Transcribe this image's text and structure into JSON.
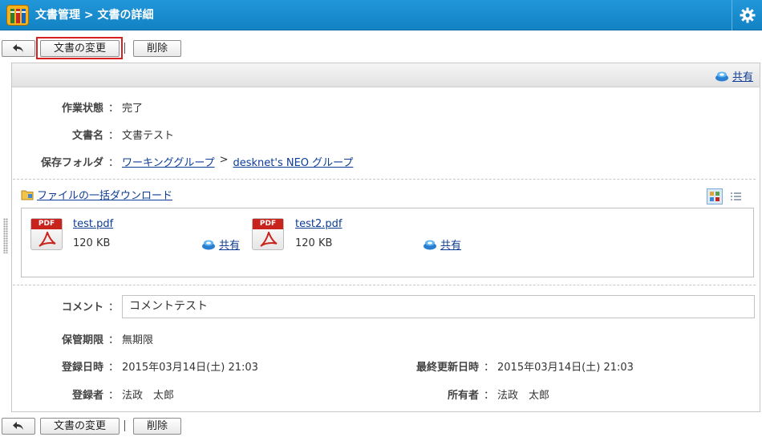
{
  "window": {
    "breadcrumb": "文書管理 > 文書の詳細"
  },
  "toolbar": {
    "back_icon": "back-arrow-icon",
    "edit_label": "文書の変更",
    "delete_label": "削除"
  },
  "panel": {
    "share_label": "共有",
    "status": {
      "label": "作業状態",
      "colon": "：",
      "value": "完了"
    },
    "doc_name": {
      "label": "文書名",
      "colon": "：",
      "value": "文書テスト"
    },
    "folder": {
      "label": "保存フォルダ",
      "colon": "：",
      "path": [
        "ワーキンググループ",
        "desknet's NEO グループ"
      ],
      "separator": ">"
    },
    "bulk_download_label": "ファイルの一括ダウンロード",
    "files": [
      {
        "type_tag": "PDF",
        "name": "test.pdf",
        "size": "120 KB",
        "share_label": "共有"
      },
      {
        "type_tag": "PDF",
        "name": "test2.pdf",
        "size": "120 KB",
        "share_label": "共有"
      }
    ],
    "comment": {
      "label": "コメント",
      "colon": "：",
      "value": "コメントテスト"
    },
    "retention": {
      "label": "保管期限",
      "colon": "：",
      "value": "無期限"
    },
    "registered_at": {
      "label": "登録日時",
      "colon": "：",
      "value": "2015年03月14日(土) 21:03"
    },
    "updated_at": {
      "label": "最終更新日時",
      "colon": "：",
      "value": "2015年03月14日(土) 21:03"
    },
    "registrant": {
      "label": "登録者",
      "colon": "：",
      "value": "法政　太郎"
    },
    "owner": {
      "label": "所有者",
      "colon": "：",
      "value": "法政　太郎"
    }
  },
  "colors": {
    "titlebar": "#1283c5",
    "link": "#0d3c94",
    "highlight": "#d72020",
    "pdf_red": "#c9231d"
  }
}
